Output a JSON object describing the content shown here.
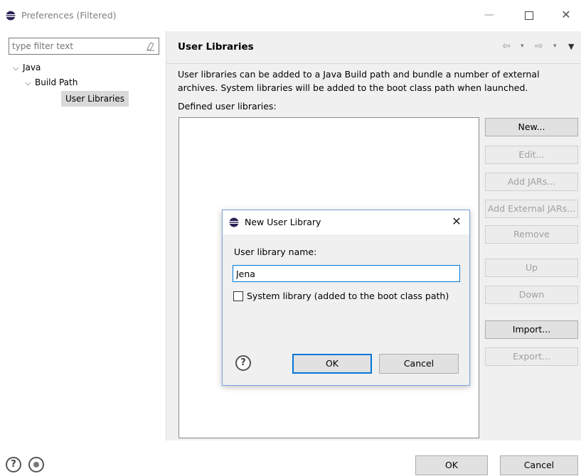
{
  "window": {
    "title": "Preferences (Filtered)",
    "min_glyph": "—",
    "close_glyph": "✕"
  },
  "filter": {
    "placeholder": "type filter text"
  },
  "tree": {
    "java": "Java",
    "build_path": "Build Path",
    "user_libraries": "User Libraries",
    "expanded_glyph": "⌵"
  },
  "page": {
    "title": "User Libraries",
    "description_line1": "User libraries can be added to a Java Build path and bundle a number of external",
    "description_line2": "archives. System libraries will be added to the boot class path when launched.",
    "defined_label": "Defined user libraries:",
    "nav_back_glyph": "⇦",
    "nav_fwd_glyph": "⇨",
    "dropdown_glyph": "▾",
    "view_menu_glyph": "▼"
  },
  "side_buttons": {
    "new": "New...",
    "edit": "Edit...",
    "add_jars": "Add JARs...",
    "add_external_jars": "Add External JARs...",
    "remove": "Remove",
    "up": "Up",
    "down": "Down",
    "import": "Import...",
    "export": "Export..."
  },
  "footer": {
    "help_glyph": "?",
    "ok": "OK",
    "cancel": "Cancel"
  },
  "dialog": {
    "title": "New User Library",
    "close_glyph": "✕",
    "name_label": "User library name:",
    "name_value": "Jena",
    "system_library_label": "System library (added to the boot class path)",
    "system_library_checked": false,
    "help_glyph": "?",
    "ok": "OK",
    "cancel": "Cancel"
  },
  "colors": {
    "accent": "#0078d7",
    "dialog_border": "#7ba2e0",
    "pane_bg": "#f0f0f0",
    "disabled_text": "#a0a0a0"
  }
}
